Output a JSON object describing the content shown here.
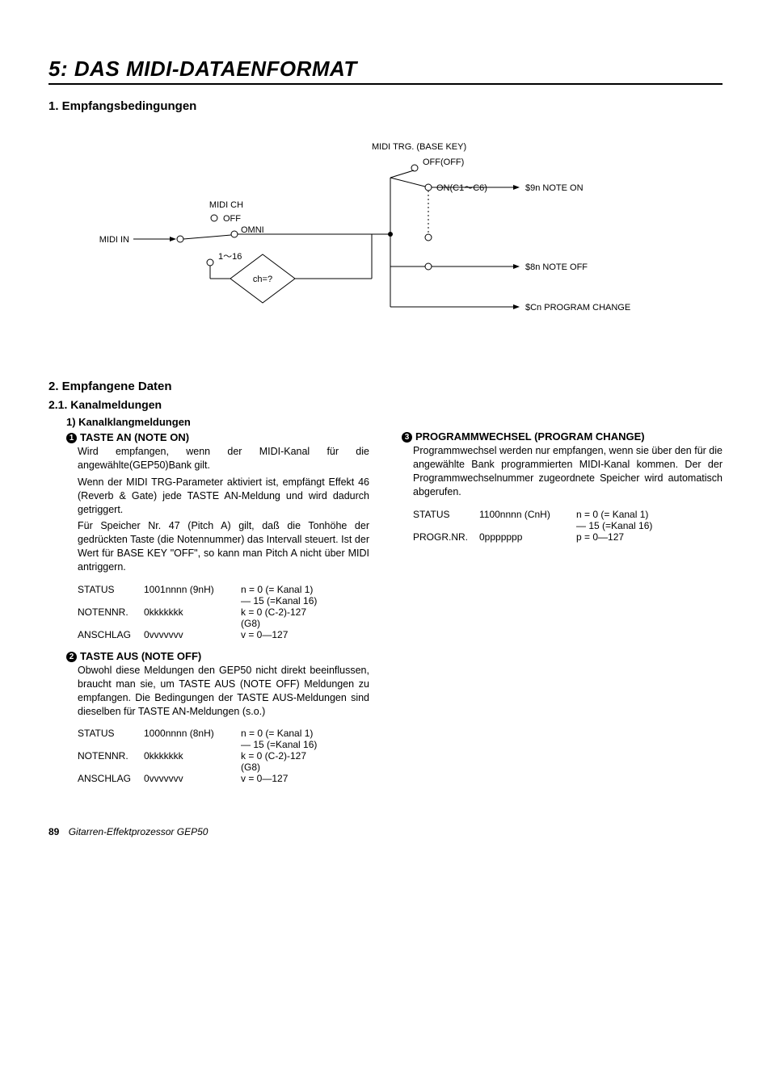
{
  "title": "5: DAS MIDI-DATAENFORMAT",
  "sec1": {
    "heading": "1. Empfangsbedingungen"
  },
  "diagram": {
    "midi_in": "MIDI IN",
    "midi_ch": "MIDI CH",
    "off1": "OFF",
    "omni": "OMNI",
    "range": "1～16",
    "ch": "ch=?",
    "trg": "MIDI TRG. (BASE KEY)",
    "offoff": "OFF(OFF)",
    "onrange": "ON(C1～C6)",
    "note_on": "$9n  NOTE ON",
    "note_off": "$8n  NOTE OFF",
    "prog_chg": "$Cn  PROGRAM CHANGE"
  },
  "sec2": {
    "heading": "2. Empfangene Daten"
  },
  "sec21": {
    "heading": "2.1. Kanalmeldungen"
  },
  "sub1": {
    "heading": "1) Kanalklangmeldungen"
  },
  "noteon": {
    "num": "1",
    "title": "TASTE AN (NOTE ON)",
    "p1": "Wird empfangen, wenn der MIDI-Kanal für die angewählte(GEP50)Bank gilt.",
    "p2": "Wenn der MIDI TRG-Parameter aktiviert ist, empfängt Effekt 46 (Reverb & Gate) jede TASTE AN-Meldung und wird dadurch getriggert.",
    "p3": "Für Speicher Nr. 47 (Pitch A) gilt, daß die Tonhöhe der gedrückten Taste (die Notennummer) das Intervall steuert. Ist der Wert für BASE KEY \"OFF\", so kann man Pitch A nicht über MIDI antriggern.",
    "rows": {
      "status_l": "STATUS",
      "status_b": "1001nnnn (9nH)",
      "status_d1": "n = 0 (= Kanal 1)",
      "status_d2": "— 15 (=Kanal 16)",
      "note_l": "NOTENNR.",
      "note_b": "0kkkkkkk",
      "note_d1": "k = 0 (C-2)-127",
      "note_d2": "(G8)",
      "vel_l": "ANSCHLAG",
      "vel_b": "0vvvvvvv",
      "vel_d": "v = 0—127"
    }
  },
  "noteoff": {
    "num": "2",
    "title": "TASTE AUS (NOTE OFF)",
    "p1": "Obwohl diese Meldungen den GEP50 nicht direkt beeinflussen, braucht man sie, um TASTE AUS (NOTE OFF) Meldungen zu empfangen. Die Bedingungen der TASTE AUS-Meldungen sind dieselben für TASTE AN-Meldungen (s.o.)",
    "rows": {
      "status_l": "STATUS",
      "status_b": "1000nnnn (8nH)",
      "status_d1": "n = 0 (= Kanal 1)",
      "status_d2": "— 15 (=Kanal 16)",
      "note_l": "NOTENNR.",
      "note_b": "0kkkkkkk",
      "note_d1": "k = 0 (C-2)-127",
      "note_d2": "(G8)",
      "vel_l": "ANSCHLAG",
      "vel_b": "0vvvvvvv",
      "vel_d": "v = 0—127"
    }
  },
  "progchg": {
    "num": "3",
    "title": "PROGRAMMWECHSEL (PROGRAM CHANGE)",
    "p1": "Programmwechsel werden nur empfangen, wenn sie über den für die angewählte Bank programmierten MIDI-Kanal kommen. Der der Programmwechselnummer zugeordnete Speicher wird automatisch abgerufen.",
    "rows": {
      "status_l": "STATUS",
      "status_b": "1100nnnn (CnH)",
      "status_d1": "n = 0 (= Kanal 1)",
      "status_d2": "— 15 (=Kanal 16)",
      "prog_l": "PROGR.NR.",
      "prog_b": "0ppppppp",
      "prog_d": "p = 0—127"
    }
  },
  "footer": {
    "page": "89",
    "title": "Gitarren-Effektprozessor GEP50"
  }
}
